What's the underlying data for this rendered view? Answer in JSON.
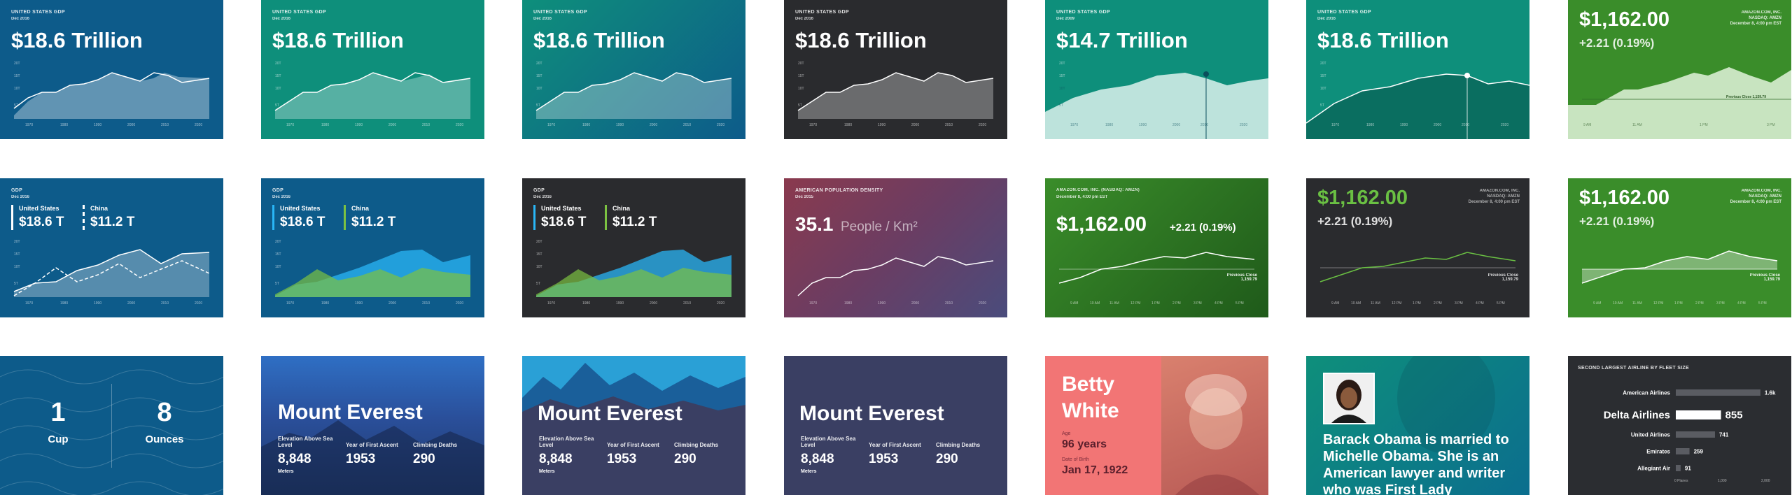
{
  "colors": {
    "blue": "#0d5b8a",
    "teal": "#0e8f7b",
    "dark": "#2a2b2e",
    "green": "#3a8d2a",
    "mauve": "#7a3f5e",
    "navy": "#3a3f63",
    "salmon": "#f27575",
    "slate": "#2b2d31"
  },
  "gdp_cards": [
    {
      "title": "UNITED STATES GDP",
      "subtitle": "Dec 2016",
      "value": "$18.6 Trillion",
      "theme": "blue"
    },
    {
      "title": "UNITED STATES GDP",
      "subtitle": "Dec 2016",
      "value": "$18.6 Trillion",
      "theme": "teal"
    },
    {
      "title": "UNITED STATES GDP",
      "subtitle": "Dec 2016",
      "value": "$18.6 Trillion",
      "theme": "tealblue"
    },
    {
      "title": "UNITED STATES GDP",
      "subtitle": "Dec 2016",
      "value": "$18.6 Trillion",
      "theme": "dark"
    },
    {
      "title": "UNITED STATES GDP",
      "subtitle": "Dec 2009",
      "value": "$14.7 Trillion",
      "theme": "teal-light"
    },
    {
      "title": "UNITED STATES GDP",
      "subtitle": "Dec 2016",
      "value": "$18.6 Trillion",
      "theme": "teal-dark"
    }
  ],
  "gdp_axis": {
    "x": [
      "1970",
      "1980",
      "1990",
      "2000",
      "2010",
      "2020"
    ],
    "y": [
      "20T",
      "15T",
      "10T",
      "5T"
    ]
  },
  "comparison_cards": [
    {
      "title": "GDP",
      "subtitle": "Dec 2016",
      "a_name": "United States",
      "a_value": "$18.6 T",
      "b_name": "China",
      "b_value": "$11.2 T"
    },
    {
      "title": "GDP",
      "subtitle": "Dec 2016",
      "a_name": "United States",
      "a_value": "$18.6 T",
      "b_name": "China",
      "b_value": "$11.2 T"
    },
    {
      "title": "GDP",
      "subtitle": "Dec 2016",
      "a_name": "United States",
      "a_value": "$18.6 T",
      "b_name": "China",
      "b_value": "$11.2 T"
    }
  ],
  "density": {
    "title": "AMERICAN POPULATION DENSITY",
    "subtitle": "Dec 2015",
    "value": "35.1",
    "unit": "People / Km²"
  },
  "stock": {
    "price": "$1,162.00",
    "change": "+2.21 (0.19%)",
    "company": "AMAZON.COM, INC.",
    "exchange": "NASDAQ: AMZN",
    "company_line": "AMAZON.COM, INC. (NASDAQ: AMZN)",
    "date": "December 8, 4:00 pm EST",
    "prev_close_label": "Previous Close",
    "prev_close_value": "1,159.79",
    "prev_close_inline": "Previous Close 1,159.79",
    "times": [
      "9 AM",
      "10 AM",
      "11 AM",
      "12 PM",
      "1 PM",
      "2 PM",
      "3 PM",
      "4 PM",
      "5 PM"
    ]
  },
  "cup": {
    "a_value": "1",
    "a_unit": "Cup",
    "b_value": "8",
    "b_unit": "Ounces"
  },
  "everest": {
    "name": "Mount Everest",
    "elev_label": "Elevation Above Sea Level",
    "elev_value": "8,848",
    "elev_unit": "Meters",
    "ascent_label": "Year of First Ascent",
    "ascent_value": "1953",
    "deaths_label": "Climbing Deaths",
    "deaths_value": "290"
  },
  "betty": {
    "first": "Betty",
    "last": "White",
    "age_label": "Age",
    "age_value": "96 years",
    "dob_label": "Date of Birth",
    "dob_value": "Jan 17, 1922"
  },
  "obama": {
    "text": "Barack Obama is married to Michelle Obama. She is an American lawyer and writer who was First Lady"
  },
  "airlines": {
    "title": "SECOND LARGEST AIRLINE BY FLEET SIZE",
    "axis": [
      "0 Planes",
      "1,000",
      "2,000"
    ],
    "chart_data": {
      "type": "bar",
      "categories": [
        "American Airlines",
        "Delta Airlines",
        "United Airlines",
        "Emirates",
        "Allegiant Air"
      ],
      "values": [
        1600,
        855,
        741,
        259,
        91
      ],
      "labels": [
        "1.6k",
        "855",
        "741",
        "259",
        "91"
      ],
      "highlight": "Delta Airlines"
    }
  }
}
